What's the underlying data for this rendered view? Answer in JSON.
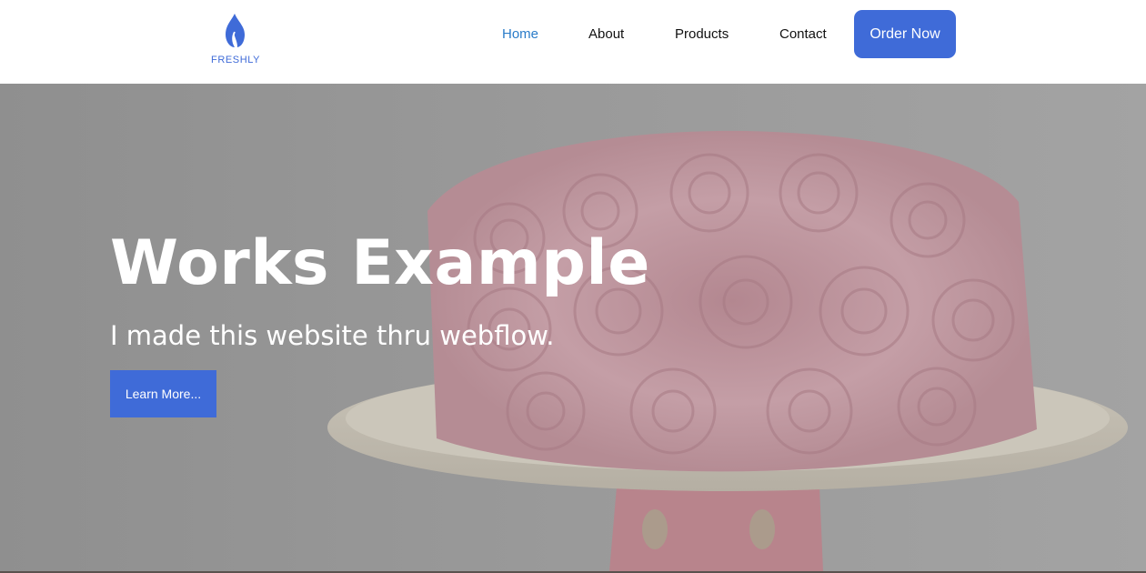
{
  "brand": {
    "name": "FRESHLY",
    "logo_icon": "flame-icon",
    "color": "#3F6BD8"
  },
  "nav": {
    "items": [
      {
        "label": "Home",
        "active": true
      },
      {
        "label": "About",
        "active": false
      },
      {
        "label": "Products",
        "active": false
      },
      {
        "label": "Contact",
        "active": false
      }
    ],
    "active_color": "#2A7CC9",
    "cta_label": "Order Now",
    "cta_color": "#3F6BD8"
  },
  "hero": {
    "title": "Works Example",
    "subtitle": "I made this website thru webflow.",
    "button_label": "Learn More...",
    "button_color": "#3F6BD8",
    "background_image": "pink rose frosting cake on a cake stand"
  }
}
